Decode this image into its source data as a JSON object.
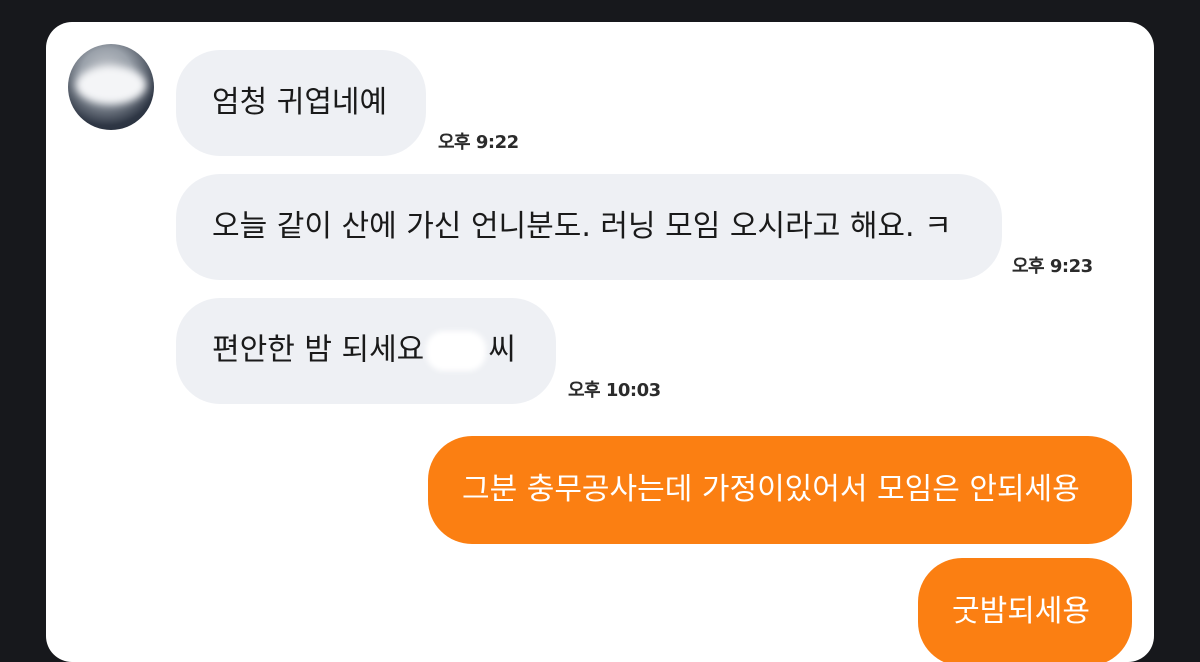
{
  "messages": [
    {
      "direction": "incoming",
      "text": "엄청 귀엽네예",
      "time": "오후 9:22"
    },
    {
      "direction": "incoming",
      "text": "오늘 같이 산에 가신 언니분도. 러닝 모임 오시라고 해요. ㅋ",
      "time": "오후 9:23"
    },
    {
      "direction": "incoming",
      "text_before": "편안한 밤 되세요",
      "text_after": "씨",
      "time": "오후 10:03"
    },
    {
      "direction": "outgoing",
      "text": "그분 충무공사는데 가정이있어서 모임은 안되세용"
    },
    {
      "direction": "outgoing",
      "text": "굿밤되세용"
    }
  ],
  "colors": {
    "page_background": "#17181c",
    "panel_background": "#ffffff",
    "incoming_bubble": "#eef0f4",
    "outgoing_bubble": "#fb7f12",
    "outgoing_text": "#ffffff"
  }
}
